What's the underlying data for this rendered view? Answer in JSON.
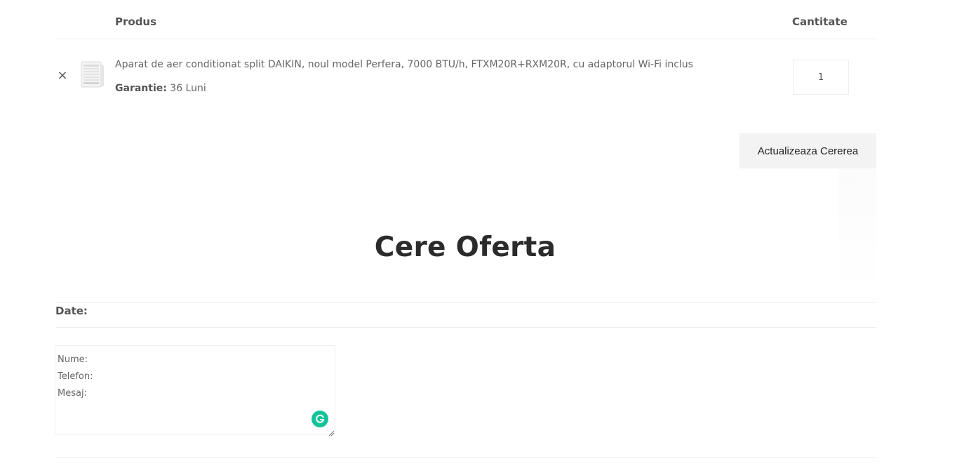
{
  "table": {
    "header_product": "Produs",
    "header_quantity": "Cantitate"
  },
  "row": {
    "remove_symbol": "×",
    "product_name": "Aparat de aer conditionat split DAIKIN, noul model Perfera, 7000 BTU/h, FTXM20R+RXM20R, cu adaptorul Wi-Fi inclus",
    "warranty_label": "Garantie:",
    "warranty_value": "36 Luni",
    "quantity": "1"
  },
  "update_button": "Actualizeaza Cererea",
  "section_title": "Cere Oferta",
  "form": {
    "date_label": "Date:",
    "message_lines": [
      "Nume:",
      "Telefon:",
      "Mesaj:"
    ]
  },
  "icons": {
    "remove": "close-icon",
    "thumbnail": "air-conditioner-icon",
    "grammarly": "grammarly-icon",
    "resize": "resize-handle-icon"
  },
  "colors": {
    "grammarly": "#15c39a",
    "button_bg": "#f3f3f3"
  }
}
